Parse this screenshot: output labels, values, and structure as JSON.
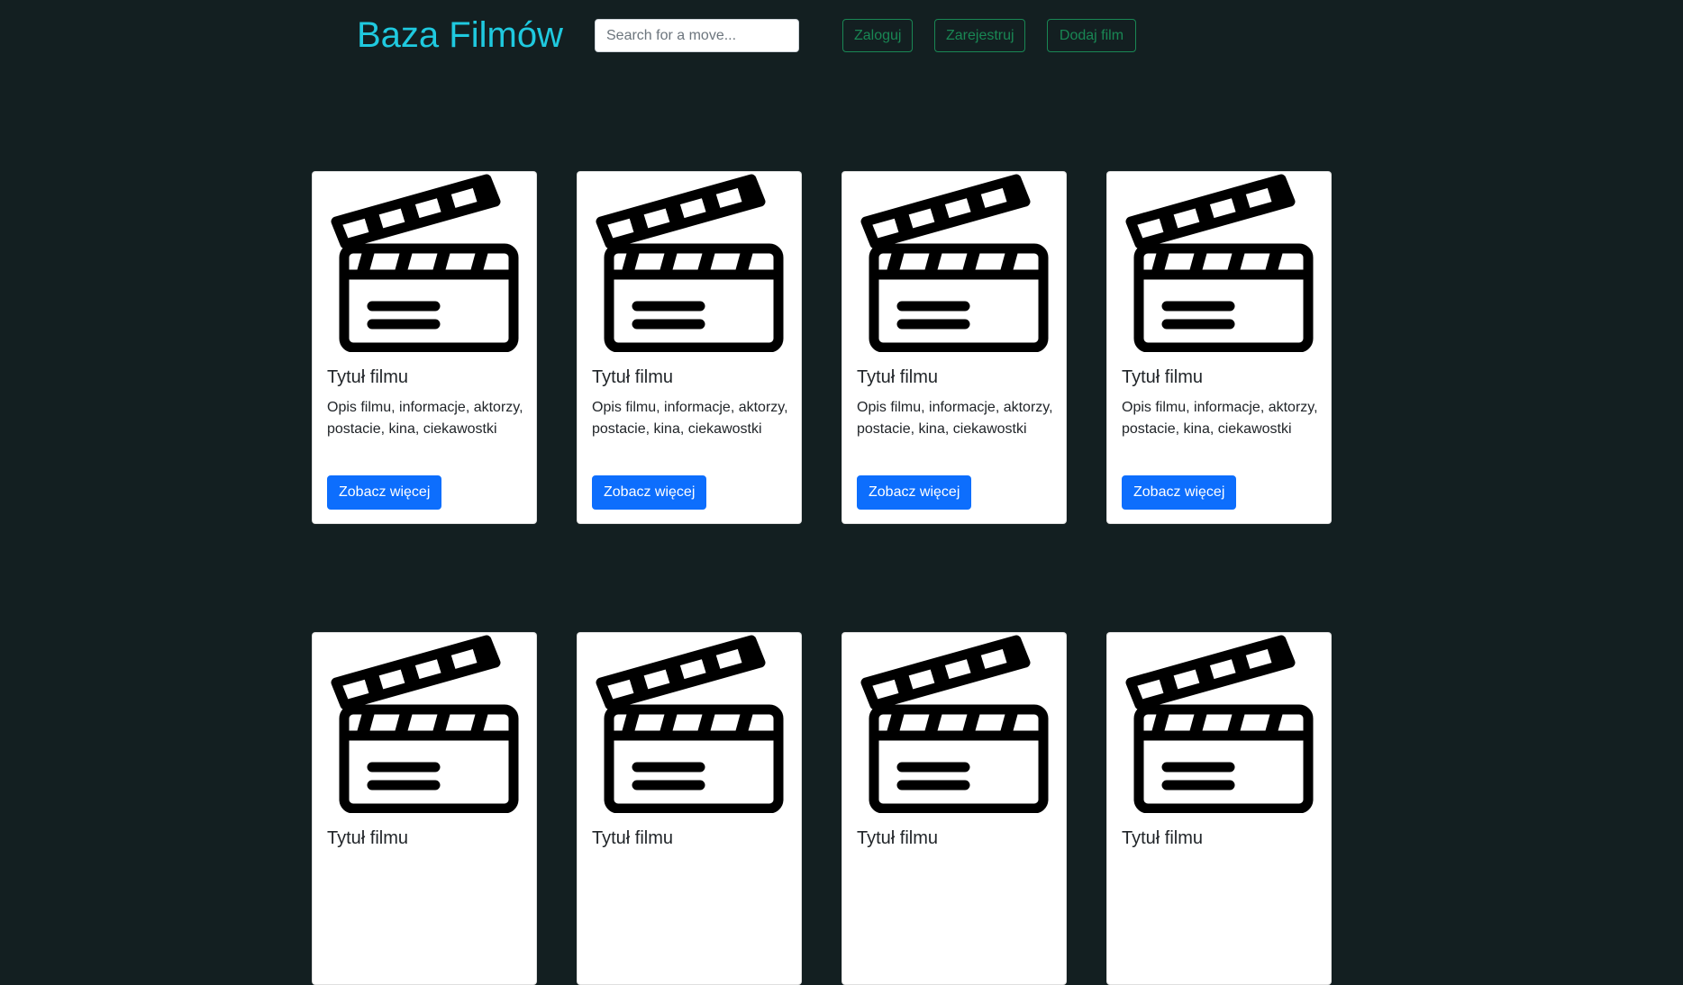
{
  "header": {
    "title": "Baza Filmów",
    "search_placeholder": "Search for a move...",
    "search_value": "",
    "login_label": "Zaloguj",
    "register_label": "Zarejestruj",
    "add_film_label": "Dodaj film"
  },
  "colors": {
    "background": "#131f21",
    "title": "#1fc9df",
    "outline_button": "#198754",
    "primary_button": "#0d6efd"
  },
  "cards": [
    {
      "image_icon": "clapperboard-icon",
      "title": "Tytuł filmu",
      "text": "Opis filmu, informacje, aktorzy, postacie, kina, ciekawostki",
      "button": "Zobacz więcej"
    },
    {
      "image_icon": "clapperboard-icon",
      "title": "Tytuł filmu",
      "text": "Opis filmu, informacje, aktorzy, postacie, kina, ciekawostki",
      "button": "Zobacz więcej"
    },
    {
      "image_icon": "clapperboard-icon",
      "title": "Tytuł filmu",
      "text": "Opis filmu, informacje, aktorzy, postacie, kina, ciekawostki",
      "button": "Zobacz więcej"
    },
    {
      "image_icon": "clapperboard-icon",
      "title": "Tytuł filmu",
      "text": "Opis filmu, informacje, aktorzy, postacie, kina, ciekawostki",
      "button": "Zobacz więcej"
    },
    {
      "image_icon": "clapperboard-icon",
      "title": "Tytuł filmu",
      "text": "",
      "button": ""
    },
    {
      "image_icon": "clapperboard-icon",
      "title": "Tytuł filmu",
      "text": "",
      "button": ""
    },
    {
      "image_icon": "clapperboard-icon",
      "title": "Tytuł filmu",
      "text": "",
      "button": ""
    },
    {
      "image_icon": "clapperboard-icon",
      "title": "Tytuł filmu",
      "text": "",
      "button": ""
    }
  ]
}
